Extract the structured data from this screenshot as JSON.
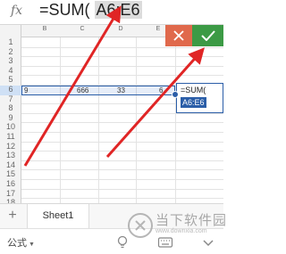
{
  "formula_bar": {
    "fx_label": "fx",
    "formula_prefix": "=SUM(",
    "formula_ref": "A6:E6"
  },
  "grid": {
    "columns": [
      "B",
      "C",
      "D",
      "E"
    ],
    "rows": [
      "1",
      "2",
      "3",
      "4",
      "5",
      "6",
      "7",
      "8",
      "9",
      "10",
      "11",
      "12",
      "13",
      "14",
      "15",
      "16",
      "17",
      "18"
    ],
    "row6_values": [
      "9",
      "666",
      "33",
      "6"
    ],
    "edit_cell": {
      "line1": "=SUM(",
      "ref": "A6:E6"
    }
  },
  "sheet_tabs": {
    "add_label": "+",
    "active_sheet": "Sheet1"
  },
  "toolbar": {
    "formula_menu_label": "公式",
    "formula_menu_arrow": "▼"
  },
  "watermark": {
    "text": "当下软件园",
    "url": "www.downxia.com"
  },
  "colors": {
    "cancel": "#e0694c",
    "confirm": "#3c9a45",
    "selection": "#2b5ea8",
    "arrow": "#e02525"
  }
}
